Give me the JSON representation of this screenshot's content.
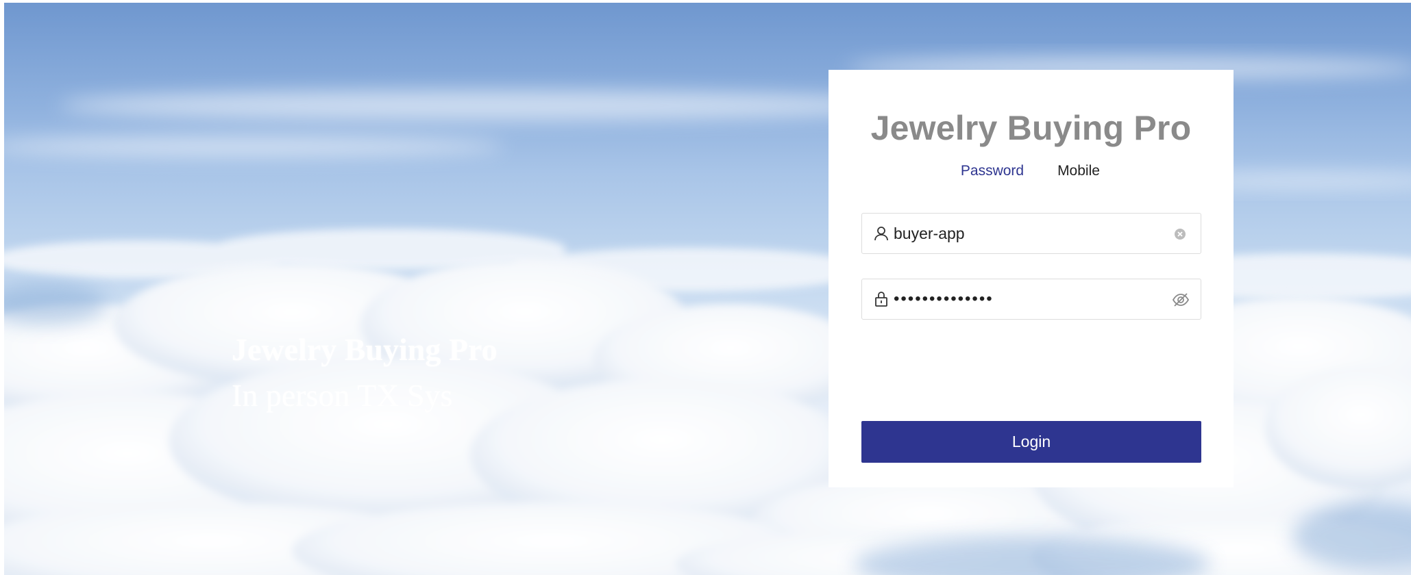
{
  "background": {
    "hero_title": "Jewelry Buying Pro",
    "hero_subtitle": "In person TX Sys"
  },
  "login_card": {
    "title": "Jewelry Buying Pro",
    "tabs": [
      {
        "label": "Password",
        "active": true
      },
      {
        "label": "Mobile",
        "active": false
      }
    ],
    "username": {
      "value": "buyer-app",
      "icon": "user-icon",
      "clear_icon": "clear-icon"
    },
    "password": {
      "value": "••••••••••••••",
      "icon": "lock-icon",
      "toggle_icon": "eye-slash-icon"
    },
    "login_label": "Login"
  },
  "colors": {
    "accent": "#2e3590",
    "title_gray": "#8a8a8a"
  }
}
